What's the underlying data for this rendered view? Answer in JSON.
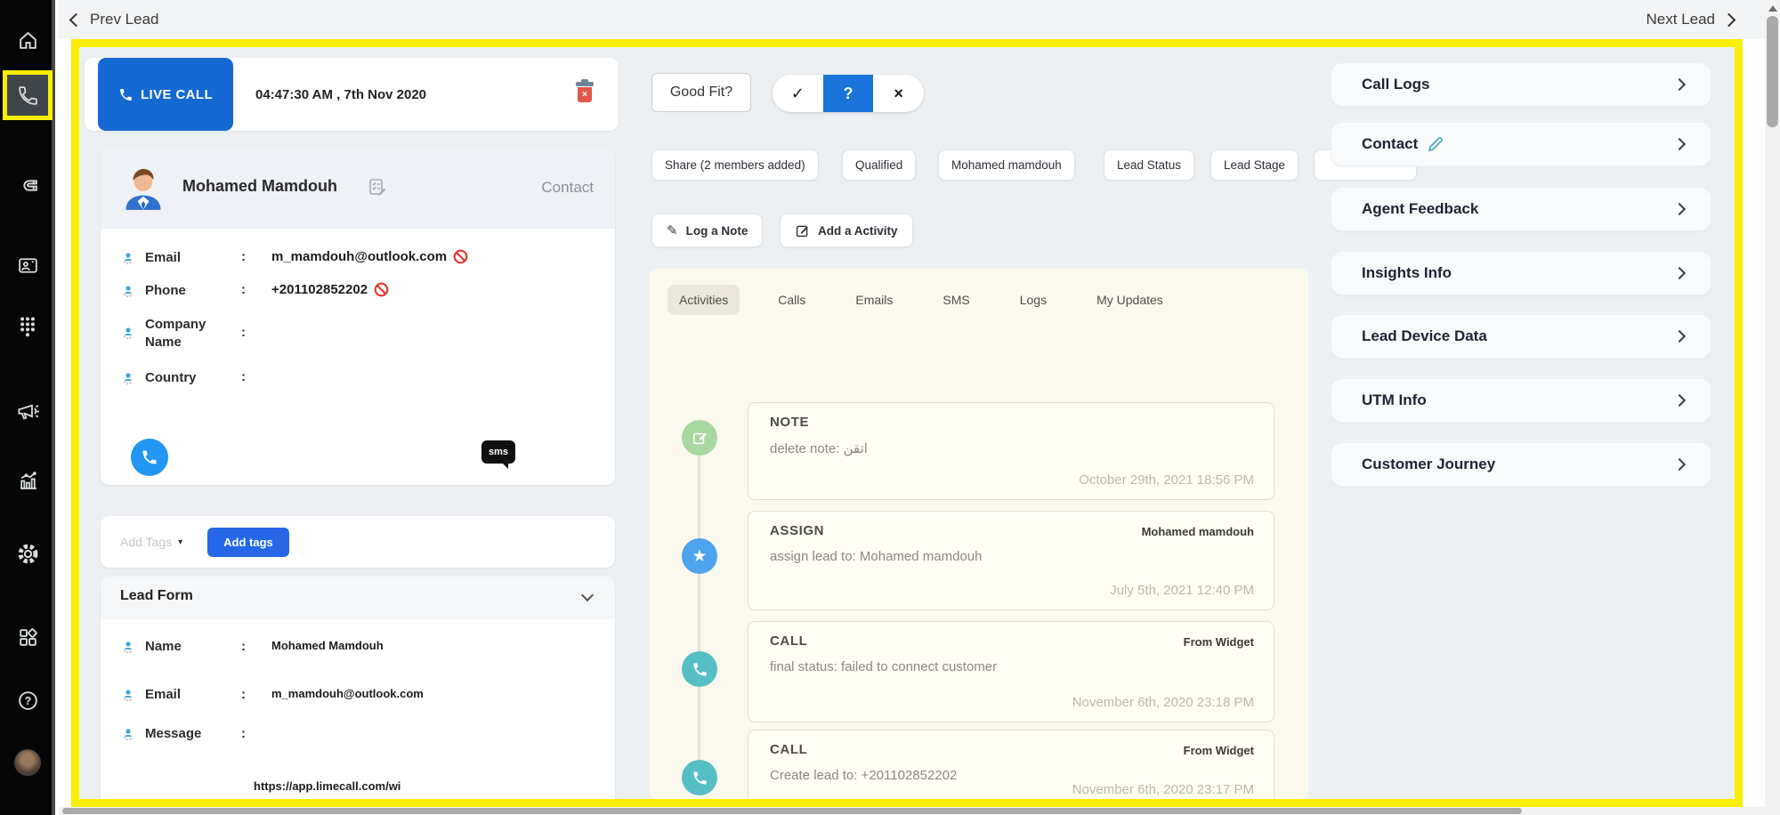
{
  "topbar": {
    "prev_label": "Prev Lead",
    "next_label": "Next Lead"
  },
  "live_call": {
    "badge_label": "LIVE CALL",
    "timestamp": "04:47:30 AM , 7th Nov 2020"
  },
  "contact": {
    "name": "Mohamed Mamdouh",
    "entity_label": "Contact",
    "colon": ":",
    "fields": [
      {
        "label": "Email",
        "value": "m_mamdouh@outlook.com"
      },
      {
        "label": "Phone",
        "value": "+201102852202"
      },
      {
        "label": "Company Name",
        "value": ""
      },
      {
        "label": "Country",
        "value": ""
      }
    ],
    "sms_label": "sms"
  },
  "tags": {
    "dropdown_label": "Add Tags",
    "caret": "▾",
    "add_button_label": "Add tags"
  },
  "lead_form": {
    "title": "Lead Form",
    "fields": [
      {
        "label": "Name",
        "value": "Mohamed Mamdouh"
      },
      {
        "label": "Email",
        "value": "m_mamdouh@outlook.com"
      },
      {
        "label": "Message",
        "value": ""
      }
    ],
    "overflow_url": "https://app.limecall.com/wi"
  },
  "qualification": {
    "good_fit_label": "Good Fit?",
    "segments": [
      {
        "glyph": "✓"
      },
      {
        "glyph": "?"
      },
      {
        "glyph": "×"
      }
    ],
    "active_segment": "?"
  },
  "action_buttons": [
    {
      "label": "Share (2 members added)"
    },
    {
      "label": "Qualified"
    },
    {
      "label": "Mohamed mamdouh"
    },
    {
      "label": "Lead Status"
    },
    {
      "label": "Lead Stage"
    },
    {
      "label": ""
    }
  ],
  "composer": {
    "log_note_label": "Log a Note",
    "log_note_icon": "✎",
    "add_activity_label": "Add a Activity"
  },
  "activity": {
    "tabs": [
      {
        "label": "Activities"
      },
      {
        "label": "Calls"
      },
      {
        "label": "Emails"
      },
      {
        "label": "SMS"
      },
      {
        "label": "Logs"
      },
      {
        "label": "My Updates"
      }
    ],
    "active_tab": "Activities",
    "entries": [
      {
        "type": "NOTE",
        "text": "delete note: اتقن",
        "timestamp": "October 29th, 2021 18:56 PM"
      },
      {
        "type": "ASSIGN",
        "right_label": "Mohamed mamdouh",
        "text": "assign lead to: Mohamed mamdouh",
        "timestamp": "July 5th, 2021 12:40 PM"
      },
      {
        "type": "CALL",
        "right_label": "From Widget",
        "text": "final status: failed to connect customer",
        "timestamp": "November 6th, 2020 23:18 PM"
      },
      {
        "type": "CALL",
        "right_label": "From Widget",
        "text": "Create lead to: +201102852202",
        "timestamp": "November 6th, 2020 23:17 PM"
      }
    ],
    "assign_star_glyph": "★"
  },
  "right_panel": {
    "items": [
      {
        "label": "Call Logs"
      },
      {
        "label": "Contact"
      },
      {
        "label": "Agent Feedback"
      },
      {
        "label": "Insights Info"
      },
      {
        "label": "Lead Device Data"
      },
      {
        "label": "UTM Info"
      },
      {
        "label": "Customer Journey"
      }
    ]
  },
  "icons": {
    "sidebar": [
      "home-icon",
      "phone-icon",
      "magnet-icon",
      "contacts-icon",
      "dialpad-icon",
      "megaphone-icon",
      "analytics-icon",
      "settings-icon",
      "apps-icon",
      "help-icon",
      "profile-avatar"
    ],
    "misc": [
      "trash-icon",
      "checklist-edit-icon",
      "person-pin-icon",
      "blocked-icon",
      "phone-circle-icon",
      "sms-bubble-icon",
      "pencil-icon",
      "note-edit-icon",
      "star-icon",
      "call-icon",
      "chevron-icons"
    ]
  },
  "colors": {
    "accent_blue": "#1a6fd9",
    "highlight_yellow": "#f8ee00",
    "blocked_red": "#e2372f",
    "call_teal": "#56bfc4",
    "note_green": "#a8d8a0",
    "assign_blue": "#4da3ee"
  }
}
